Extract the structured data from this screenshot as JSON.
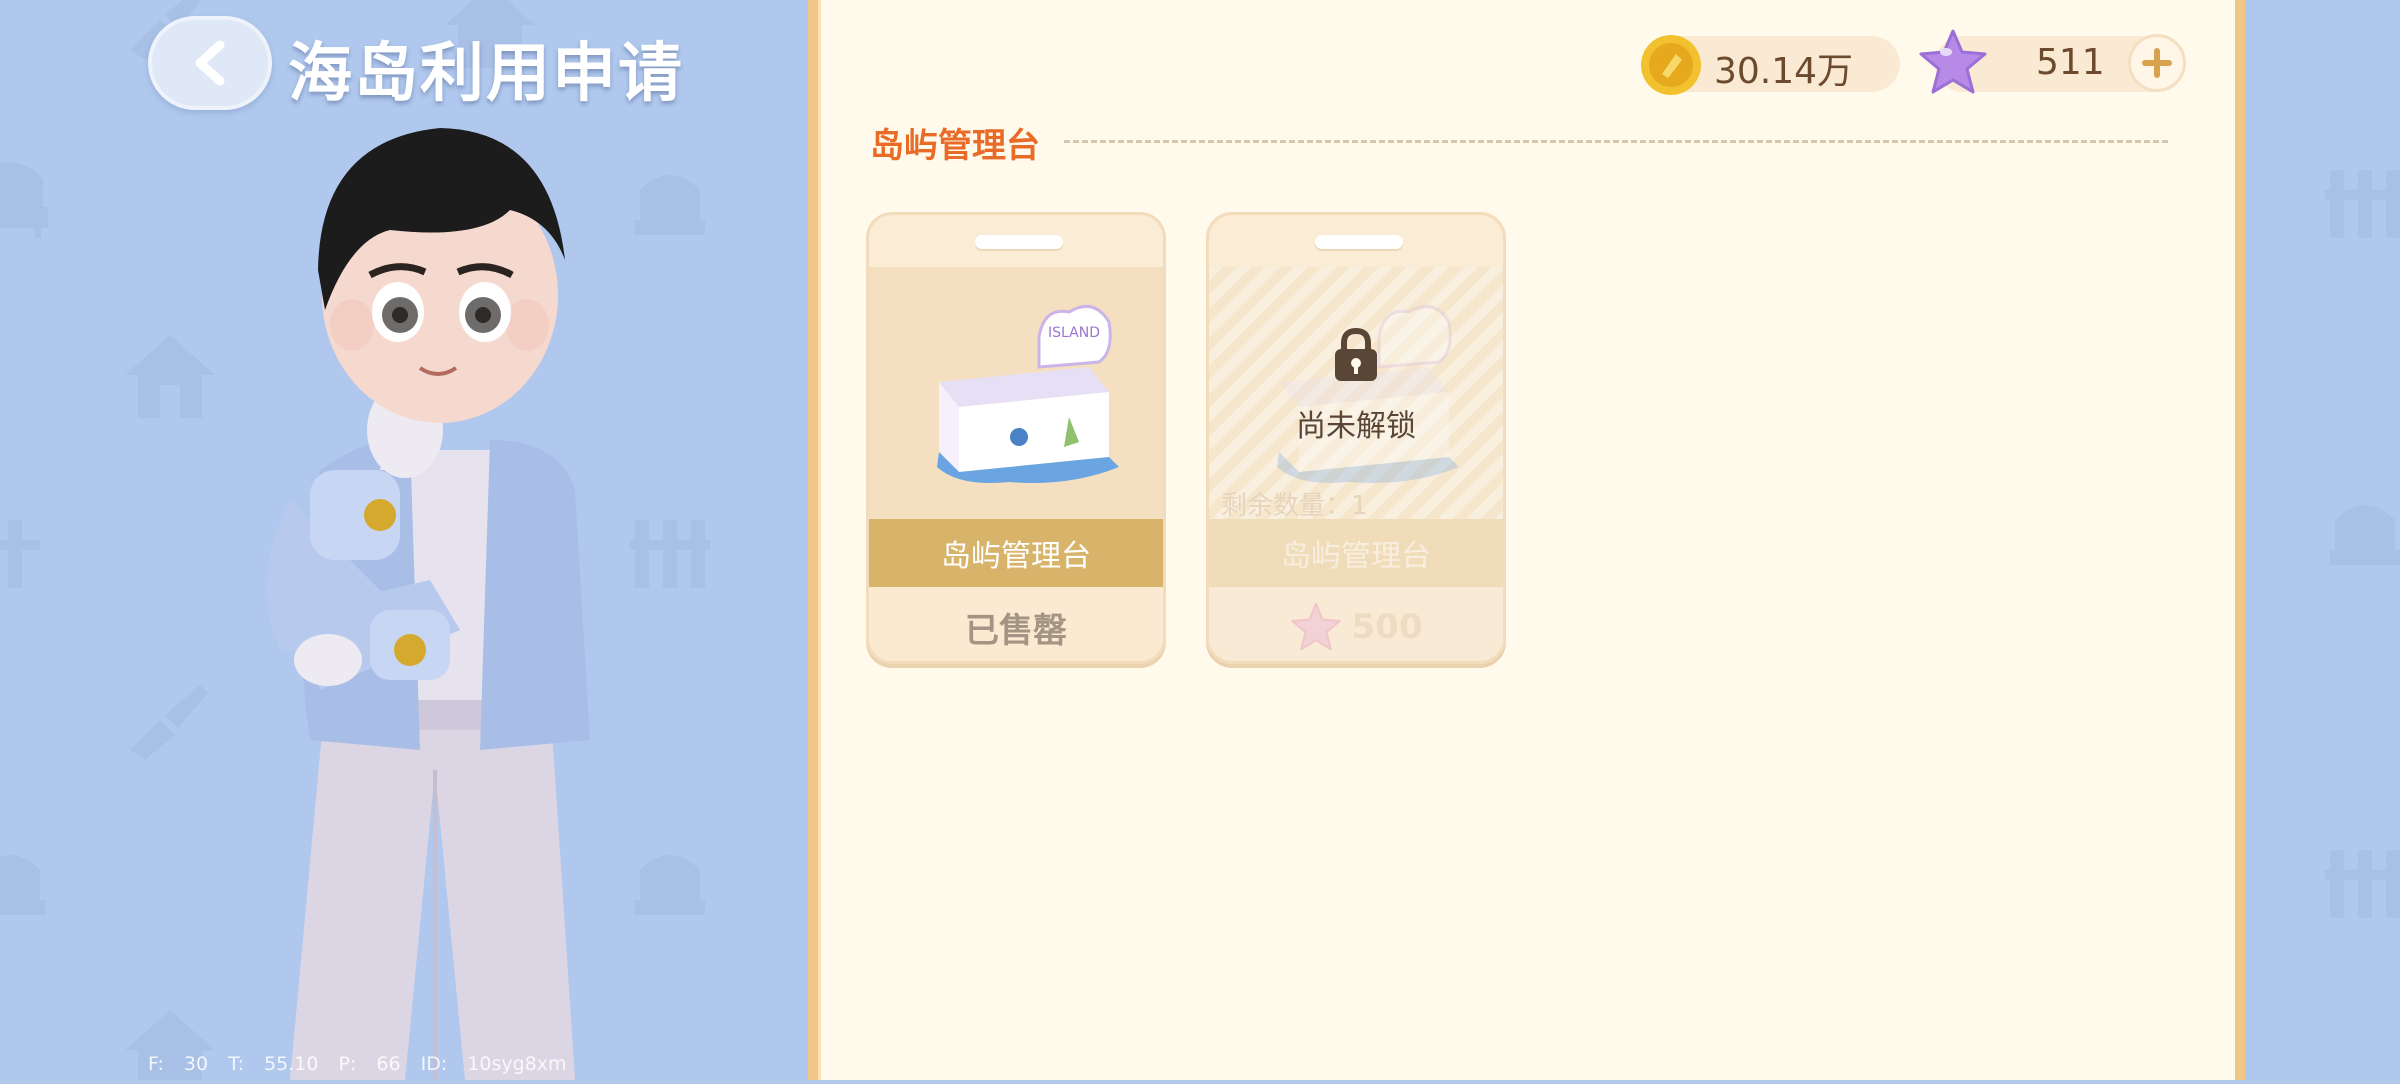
{
  "header": {
    "title": "海岛利用申请"
  },
  "currency": {
    "coins": "30.14万",
    "stars": "511"
  },
  "section": {
    "title": "岛屿管理台"
  },
  "items": [
    {
      "name": "岛屿管理台",
      "status": "已售罄"
    },
    {
      "name": "岛屿管理台",
      "lock_text": "尚未解锁",
      "remaining": "剩余数量：1",
      "price": "500"
    }
  ],
  "debug": {
    "text": "F: 30    T: 55.10    P: 66    ID: 10syg8xm"
  },
  "colors": {
    "panel_bg": "#fffaec",
    "panel_border": "#f1c689",
    "section_title": "#e86b27",
    "card_label_bar": "#d8b46b",
    "left_bg": "#b0c8ed"
  },
  "icons": [
    "back-arrow-icon",
    "coin-icon",
    "star-icon",
    "plus-icon",
    "lock-icon",
    "star-price-icon"
  ]
}
